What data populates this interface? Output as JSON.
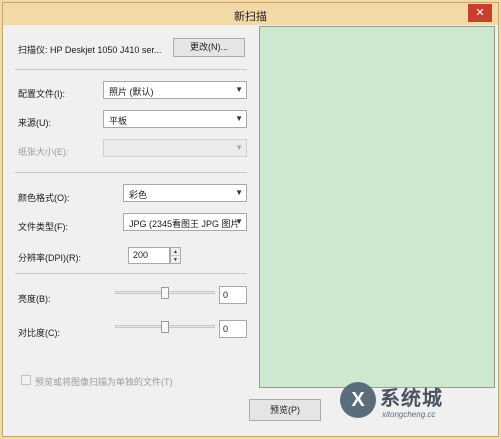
{
  "window": {
    "title": "新扫描",
    "close_glyph": "✕"
  },
  "scanner": {
    "label": "扫描仪: HP Deskjet 1050 J410 ser...",
    "change_button": "更改(N)..."
  },
  "profile": {
    "label": "配置文件(I):",
    "value": "照片 (默认)"
  },
  "source": {
    "label": "来源(U):",
    "value": "平板"
  },
  "paper_size": {
    "label": "纸张大小(E):",
    "value": ""
  },
  "color_format": {
    "label": "颜色格式(O):",
    "value": "彩色"
  },
  "file_type": {
    "label": "文件类型(F):",
    "value": "JPG (2345看图王 JPG 图片"
  },
  "resolution": {
    "label": "分辨率(DPI)(R):",
    "value": "200"
  },
  "brightness": {
    "label": "亮度(B):",
    "value": "0",
    "level": 0.5
  },
  "contrast": {
    "label": "对比度(C):",
    "value": "0",
    "level": 0.5
  },
  "preview_separate": {
    "label": "预览或将图像扫描为单独的文件(T)",
    "checked": false
  },
  "preview_button": "预览(P)",
  "watermark": {
    "logo_letter": "X",
    "text": "系统城",
    "url": "xitongcheng.cc"
  },
  "colors": {
    "titlebar": "#f3d9a7",
    "preview_bg": "#cde8cf",
    "close": "#c7402f"
  }
}
